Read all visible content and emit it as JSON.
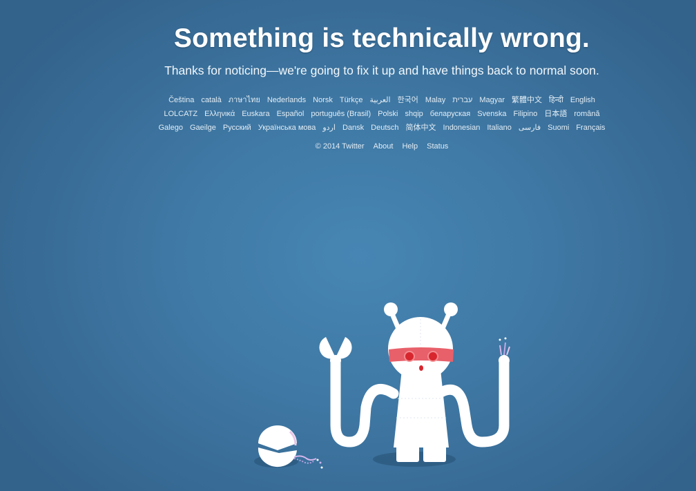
{
  "page": {
    "title": "Something is technically wrong.",
    "subtitle": "Thanks for noticing—we're going to fix it up and have things back to normal soon."
  },
  "languages": [
    "Čeština",
    "català",
    "ภาษาไทย",
    "Nederlands",
    "Norsk",
    "Türkçe",
    "العربية",
    "한국어",
    "Malay",
    "עברית",
    "Magyar",
    "繁體中文",
    "हिन्दी",
    "English",
    "LOLCATZ",
    "Ελληνικά",
    "Euskara",
    "Español",
    "português (Brasil)",
    "Polski",
    "shqip",
    "беларуская",
    "Svenska",
    "Filipino",
    "日本語",
    "română",
    "Galego",
    "Gaeilge",
    "Русский",
    "Українська мова",
    "اردو",
    "Dansk",
    "Deutsch",
    "简体中文",
    "Indonesian",
    "Italiano",
    "فارسی",
    "Suomi",
    "Français"
  ],
  "footer": {
    "copyright": "© 2014 Twitter",
    "about": "About",
    "help": "Help",
    "status": "Status"
  },
  "colors": {
    "background": "#4080b0",
    "robot_body": "#ffffff",
    "robot_visor": "#e8606a",
    "robot_eyes": "#d8262e"
  },
  "illustration": {
    "subject": "broken-robot"
  }
}
